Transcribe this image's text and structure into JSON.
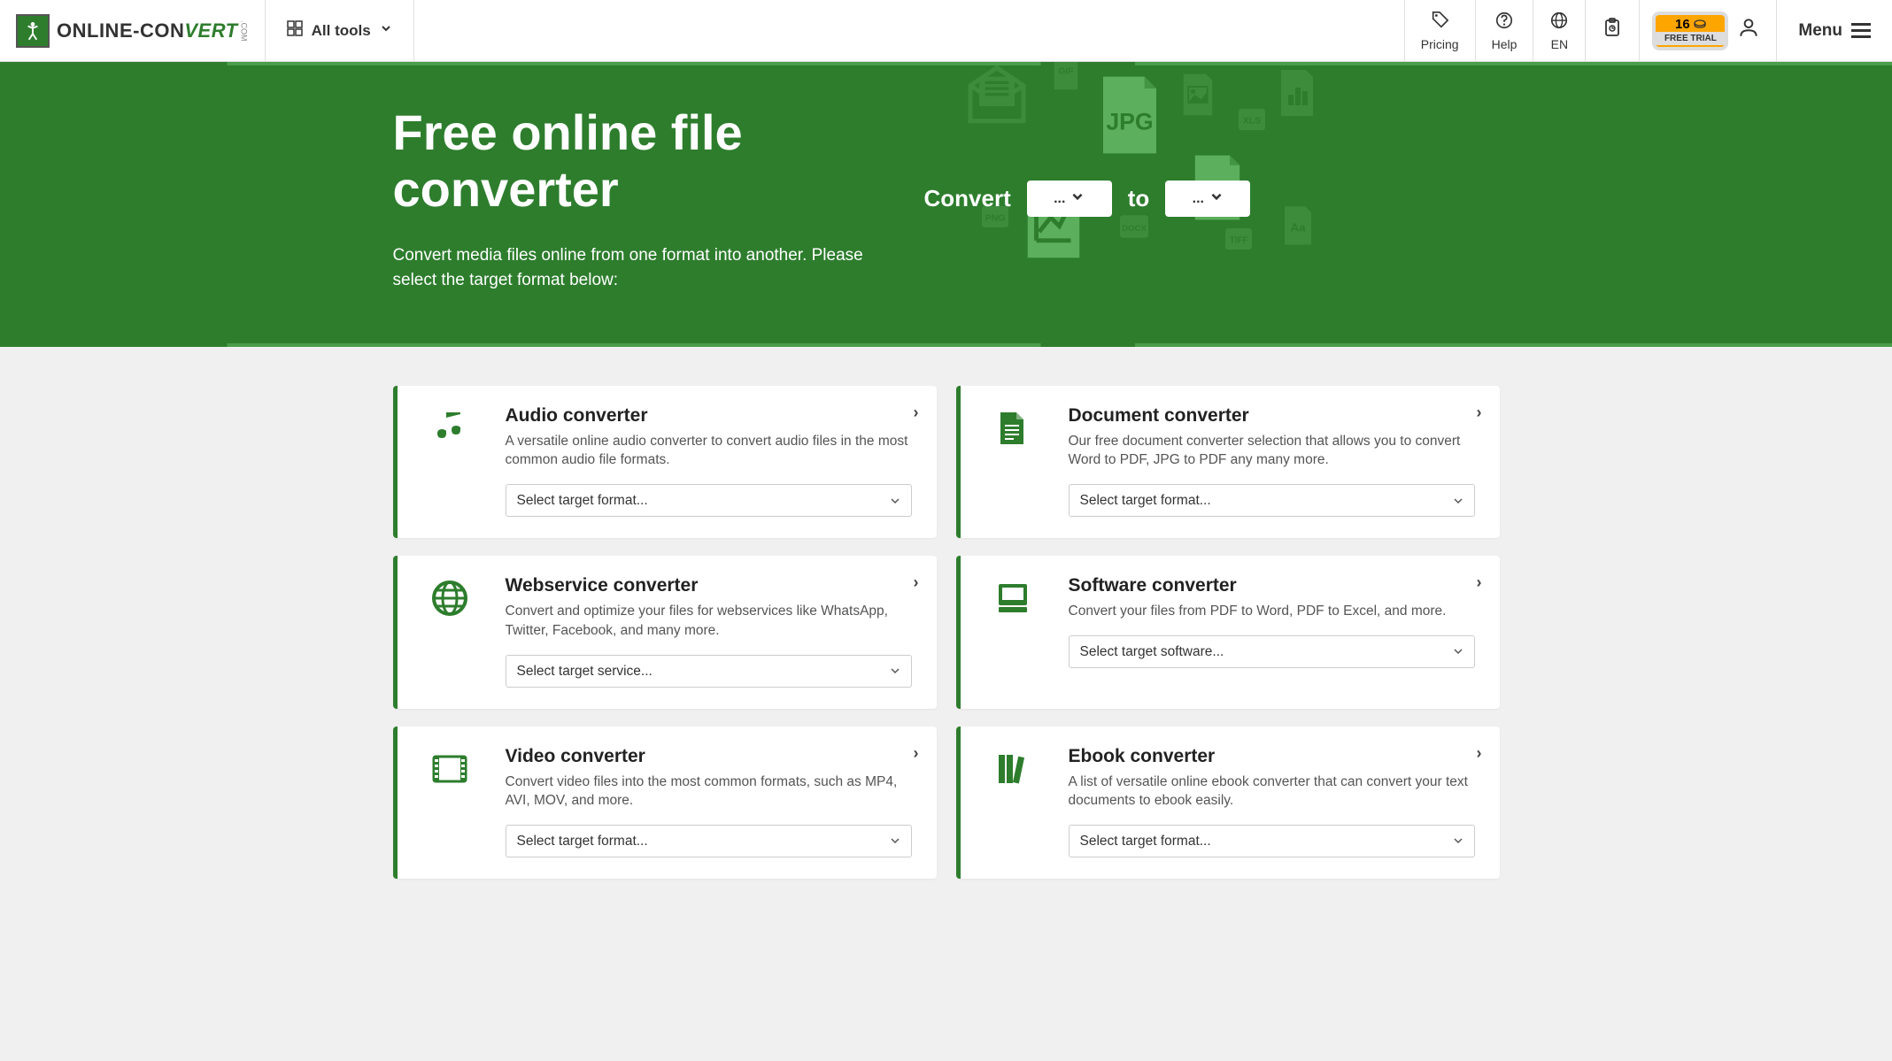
{
  "header": {
    "logo_text_1": "ONLINE-",
    "logo_text_2": "CON",
    "logo_text_3": "VERT",
    "logo_dotcom": ".COM",
    "all_tools": "All tools",
    "pricing": "Pricing",
    "help": "Help",
    "lang": "EN",
    "trial_count": "16",
    "trial_label": "FREE TRIAL",
    "menu": "Menu"
  },
  "hero": {
    "title": "Free online file converter",
    "subtitle": "Convert media files online from one format into another. Please select the target format below:",
    "convert_label": "Convert",
    "to_label": "to",
    "from_value": "...",
    "to_value": "..."
  },
  "cards": [
    {
      "title": "Audio converter",
      "desc": "A versatile online audio converter to convert audio files in the most common audio file formats.",
      "select_placeholder": "Select target format...",
      "icon": "audio"
    },
    {
      "title": "Document converter",
      "desc": "Our free document converter selection that allows you to convert Word to PDF, JPG to PDF any many more.",
      "select_placeholder": "Select target format...",
      "icon": "document"
    },
    {
      "title": "Webservice converter",
      "desc": "Convert and optimize your files for webservices like WhatsApp, Twitter, Facebook, and many more.",
      "select_placeholder": "Select target service...",
      "icon": "web"
    },
    {
      "title": "Software converter",
      "desc": "Convert your files from PDF to Word, PDF to Excel, and more.",
      "select_placeholder": "Select target software...",
      "icon": "software"
    },
    {
      "title": "Video converter",
      "desc": "Convert video files into the most common formats, such as MP4, AVI, MOV, and more.",
      "select_placeholder": "Select target format...",
      "icon": "video"
    },
    {
      "title": "Ebook converter",
      "desc": "A list of versatile online ebook converter that can convert your text documents to ebook easily.",
      "select_placeholder": "Select target format...",
      "icon": "ebook"
    }
  ]
}
